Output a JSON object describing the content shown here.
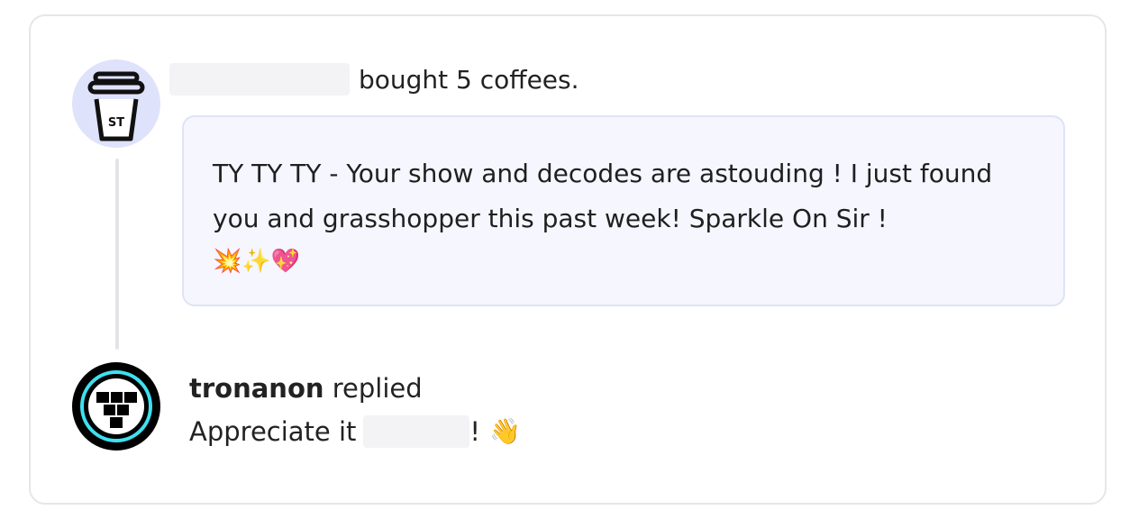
{
  "donation": {
    "supporter_text": "bought 5 coffees.",
    "avatar_initials": "ST",
    "message": "TY TY TY - Your show and decodes are astouding ! I just found you and grasshopper this past week! Sparkle On Sir !",
    "message_emojis": "💥✨💖"
  },
  "reply": {
    "author": "tronanon",
    "action": "replied",
    "text_before": "Appreciate it",
    "text_after": "!",
    "emoji": "👋"
  },
  "icons": {
    "supporter_avatar": "coffee-cup-icon",
    "creator_avatar": "tron-logo-icon"
  },
  "colors": {
    "card_border": "#e6e6ea",
    "message_bg": "#f5f6fe",
    "message_border": "#dfe3f6",
    "avatar_bg": "#dfe2fb",
    "tron_cyan": "#3fe0f0"
  }
}
